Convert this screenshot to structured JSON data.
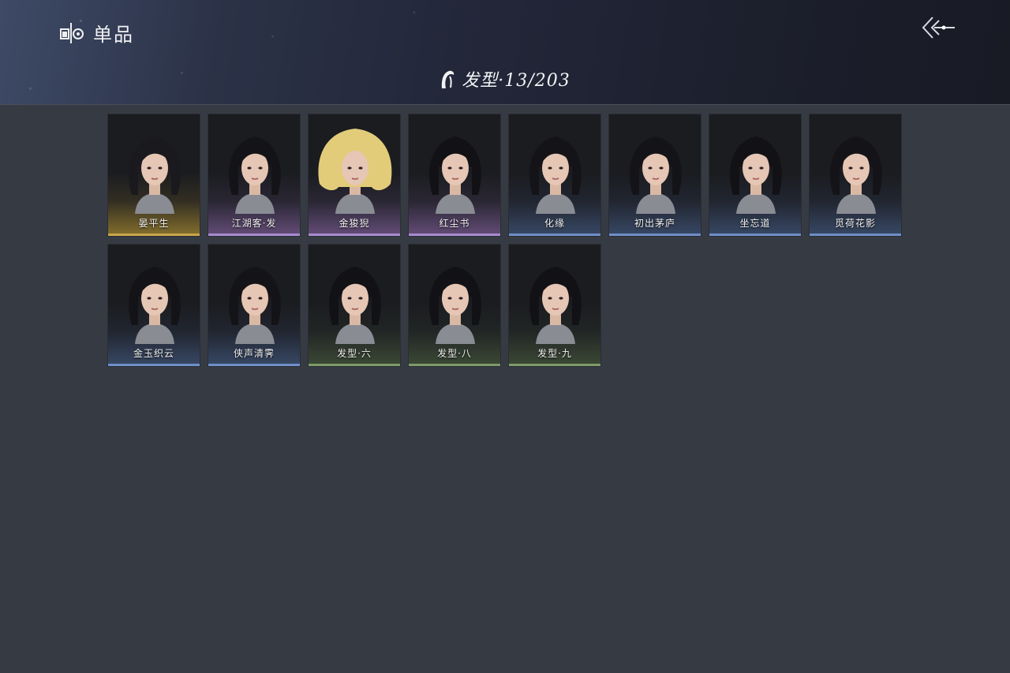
{
  "header": {
    "title": "单品",
    "category_label": "发型·13/203"
  },
  "colors": {
    "page_bg": "#363a43",
    "gold": "#c9a64a",
    "purple": "#a88bd0",
    "blue": "#6f8fc8",
    "green": "#7f9a6a"
  },
  "items": [
    {
      "name": "晏平生",
      "rarity": "gold",
      "hair_color": "#1a1a1e"
    },
    {
      "name": "江湖客·发",
      "rarity": "purple",
      "hair_color": "#141418"
    },
    {
      "name": "金狻猊",
      "rarity": "purple",
      "hair_color": "#e2cc7a"
    },
    {
      "name": "红尘书",
      "rarity": "purple",
      "hair_color": "#121216"
    },
    {
      "name": "化缘",
      "rarity": "blue",
      "hair_color": "#141418"
    },
    {
      "name": "初出茅庐",
      "rarity": "blue",
      "hair_color": "#141418"
    },
    {
      "name": "坐忘道",
      "rarity": "blue",
      "hair_color": "#121216"
    },
    {
      "name": "觅荷花影",
      "rarity": "blue",
      "hair_color": "#141418"
    },
    {
      "name": "金玉织云",
      "rarity": "blue",
      "hair_color": "#141418"
    },
    {
      "name": "侠声清霁",
      "rarity": "blue",
      "hair_color": "#141418"
    },
    {
      "name": "发型·六",
      "rarity": "green",
      "hair_color": "#121216"
    },
    {
      "name": "发型·八",
      "rarity": "green",
      "hair_color": "#121216"
    },
    {
      "name": "发型·九",
      "rarity": "green",
      "hair_color": "#121216"
    }
  ]
}
